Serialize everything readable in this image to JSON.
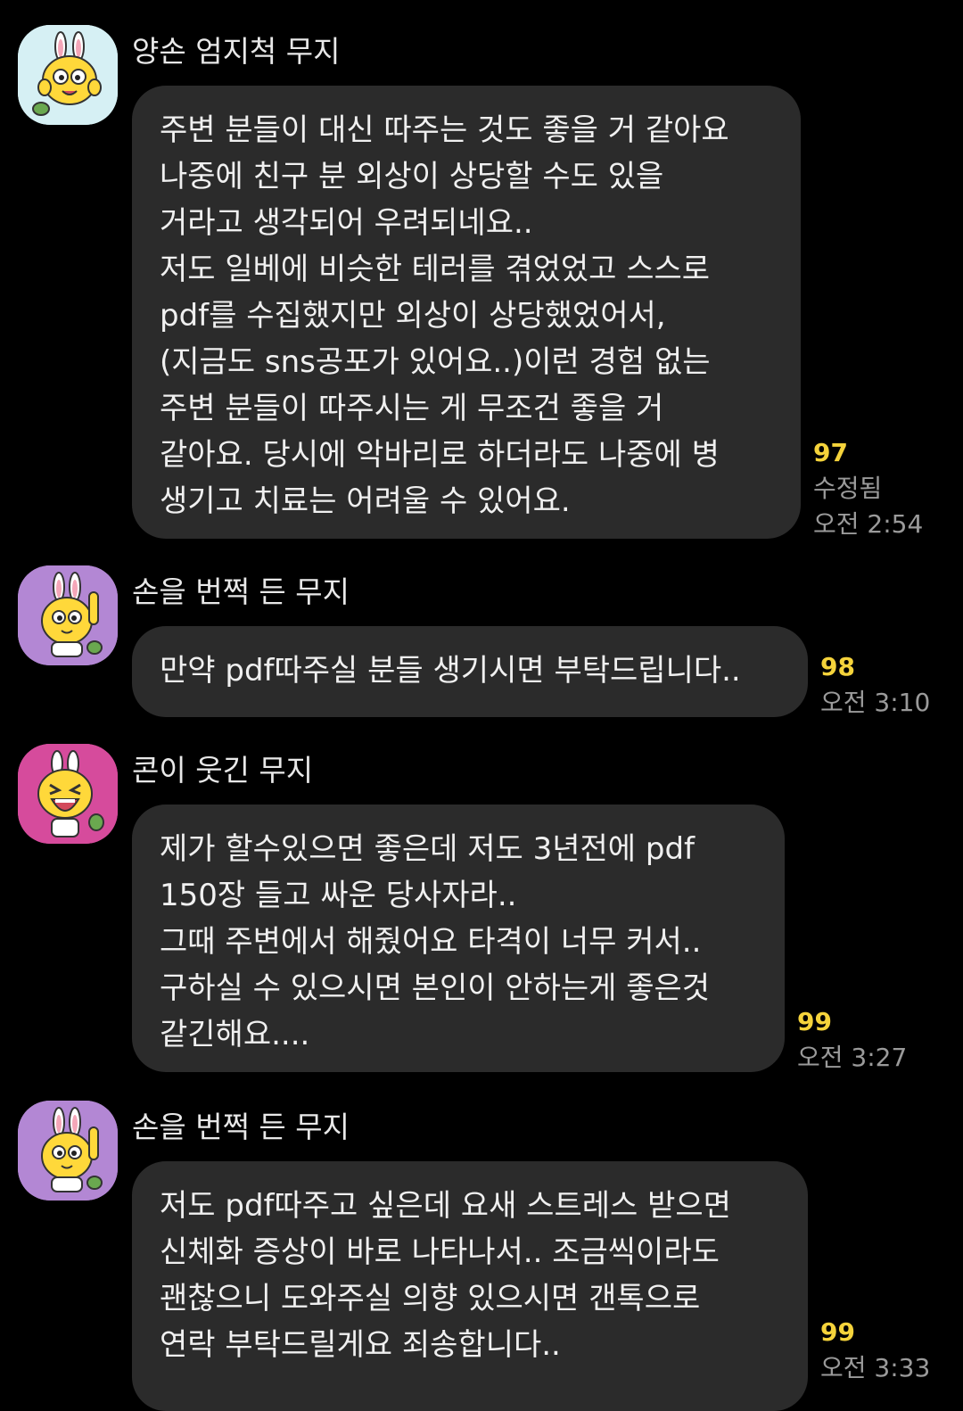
{
  "colors": {
    "background": "#000000",
    "bubble": "#2b2b2b",
    "unread_count": "#f5d33b",
    "meta_text": "#9a9a9a"
  },
  "messages": [
    {
      "sender": "양손 엄지척 무지",
      "avatar_icon": "muzi-thumbs-up-icon",
      "avatar_bg": "#d6f0f4",
      "lines": [
        "주변 분들이 대신 따주는 것도 좋을 거 같아요",
        "나중에 친구 분 외상이 상당할 수도 있을",
        "거라고 생각되어 우려되네요..",
        "저도 일베에 비슷한 테러를 겪었었고 스스로",
        "pdf를 수집했지만 외상이 상당했었어서,",
        "(지금도 sns공포가 있어요..)이런 경험 없는",
        "주변 분들이 따주시는 게 무조건 좋을 거",
        "같아요. 당시에 악바리로 하더라도 나중에 병",
        "생기고 치료는 어려울 수 있어요."
      ],
      "count": "97",
      "edited": "수정됨",
      "time": "오전 2:54"
    },
    {
      "sender": "손을 번쩍 든 무지",
      "avatar_icon": "muzi-hand-raised-icon",
      "avatar_bg": "#b387d4",
      "lines": [
        "만약 pdf따주실 분들 생기시면 부탁드립니다.."
      ],
      "count": "98",
      "time": "오전 3:10"
    },
    {
      "sender": "콘이 웃긴 무지",
      "avatar_icon": "muzi-laughing-icon",
      "avatar_bg": "#d64b9c",
      "lines": [
        "제가 할수있으면 좋은데 저도 3년전에 pdf",
        "150장 들고 싸운 당사자라..",
        "그때 주변에서 해줬어요 타격이 너무 커서..",
        "구하실 수 있으시면 본인이 안하는게 좋은것",
        "같긴해요...."
      ],
      "count": "99",
      "time": "오전 3:27"
    },
    {
      "sender": "손을 번쩍 든 무지",
      "avatar_icon": "muzi-hand-raised-icon",
      "avatar_bg": "#b387d4",
      "lines": [
        "저도 pdf따주고 싶은데 요새 스트레스 받으면",
        "신체화 증상이 바로 나타나서.. 조금씩이라도",
        "괜찮으니 도와주실 의향 있으시면 갠톡으로",
        "연락 부탁드릴게요 죄송합니다.."
      ],
      "count": "99",
      "time": "오전 3:33"
    }
  ]
}
